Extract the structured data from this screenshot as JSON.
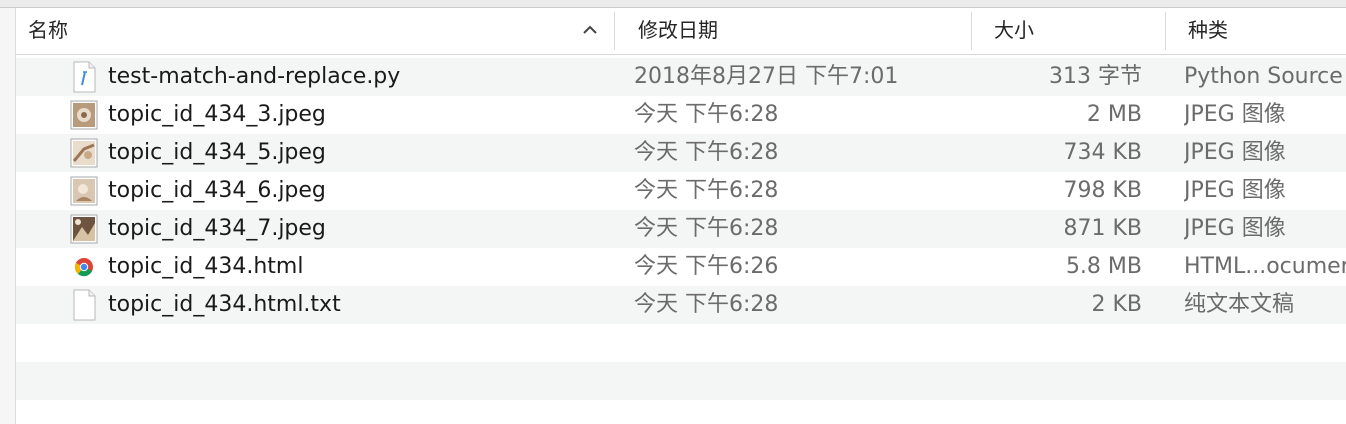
{
  "header": {
    "name": "名称",
    "date": "修改日期",
    "size": "大小",
    "kind": "种类"
  },
  "files": [
    {
      "name": "test-match-and-replace.py",
      "date": "2018年8月27日 下午7:01",
      "size": "313 字节",
      "kind": "Python Source",
      "icon": "python-file-icon"
    },
    {
      "name": "topic_id_434_3.jpeg",
      "date": "今天 下午6:28",
      "size": "2 MB",
      "kind": "JPEG 图像",
      "icon": "jpeg-thumbnail-icon"
    },
    {
      "name": "topic_id_434_5.jpeg",
      "date": "今天 下午6:28",
      "size": "734 KB",
      "kind": "JPEG 图像",
      "icon": "jpeg-thumbnail-icon"
    },
    {
      "name": "topic_id_434_6.jpeg",
      "date": "今天 下午6:28",
      "size": "798 KB",
      "kind": "JPEG 图像",
      "icon": "jpeg-thumbnail-icon"
    },
    {
      "name": "topic_id_434_7.jpeg",
      "date": "今天 下午6:28",
      "size": "871 KB",
      "kind": "JPEG 图像",
      "icon": "jpeg-thumbnail-icon"
    },
    {
      "name": "topic_id_434.html",
      "date": "今天 下午6:26",
      "size": "5.8 MB",
      "kind": "HTML...ocument",
      "icon": "chrome-html-icon"
    },
    {
      "name": "topic_id_434.html.txt",
      "date": "今天 下午6:28",
      "size": "2 KB",
      "kind": "纯文本文稿",
      "icon": "text-file-icon"
    }
  ]
}
